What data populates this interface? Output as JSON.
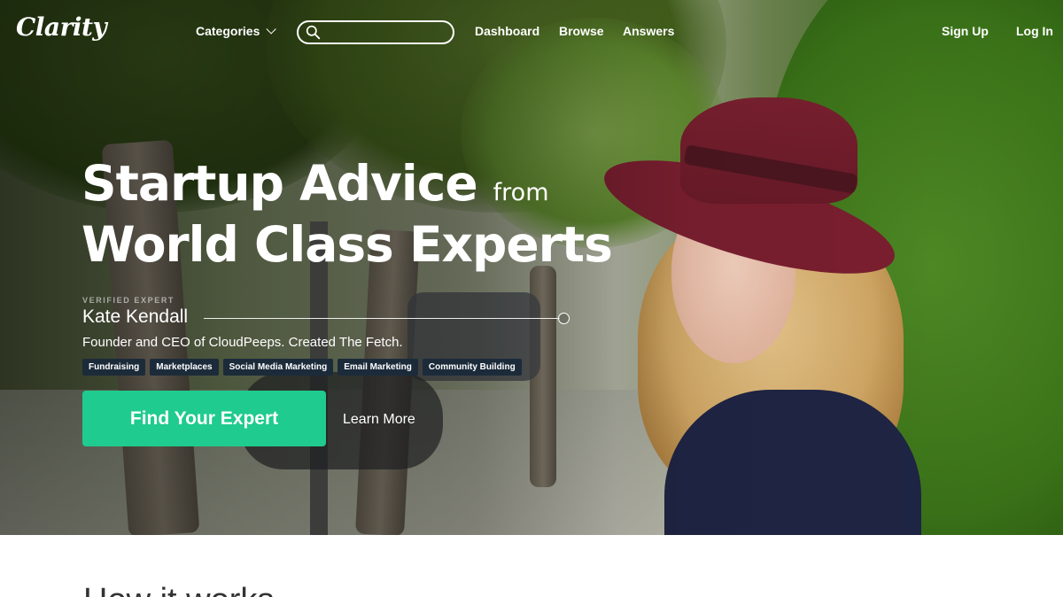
{
  "brand": {
    "logo_text": "Clarity",
    "accent_color": "#1fcb8e",
    "tag_bg_color": "#1c2b3a"
  },
  "nav": {
    "categories_label": "Categories",
    "search_placeholder": "",
    "links": [
      "Dashboard",
      "Browse",
      "Answers"
    ],
    "signup_label": "Sign Up",
    "login_label": "Log In"
  },
  "hero": {
    "headline_part1": "Startup Advice",
    "headline_from": "from",
    "headline_part2": "World Class Experts",
    "expert": {
      "badge": "VERIFIED EXPERT",
      "name": "Kate Kendall",
      "title": "Founder and CEO of CloudPeeps. Created The Fetch.",
      "tags": [
        "Fundraising",
        "Marketplaces",
        "Social Media Marketing",
        "Email Marketing",
        "Community Building"
      ]
    },
    "cta_label": "Find Your Expert",
    "learn_more_label": "Learn More"
  },
  "section": {
    "title": "How it works"
  }
}
